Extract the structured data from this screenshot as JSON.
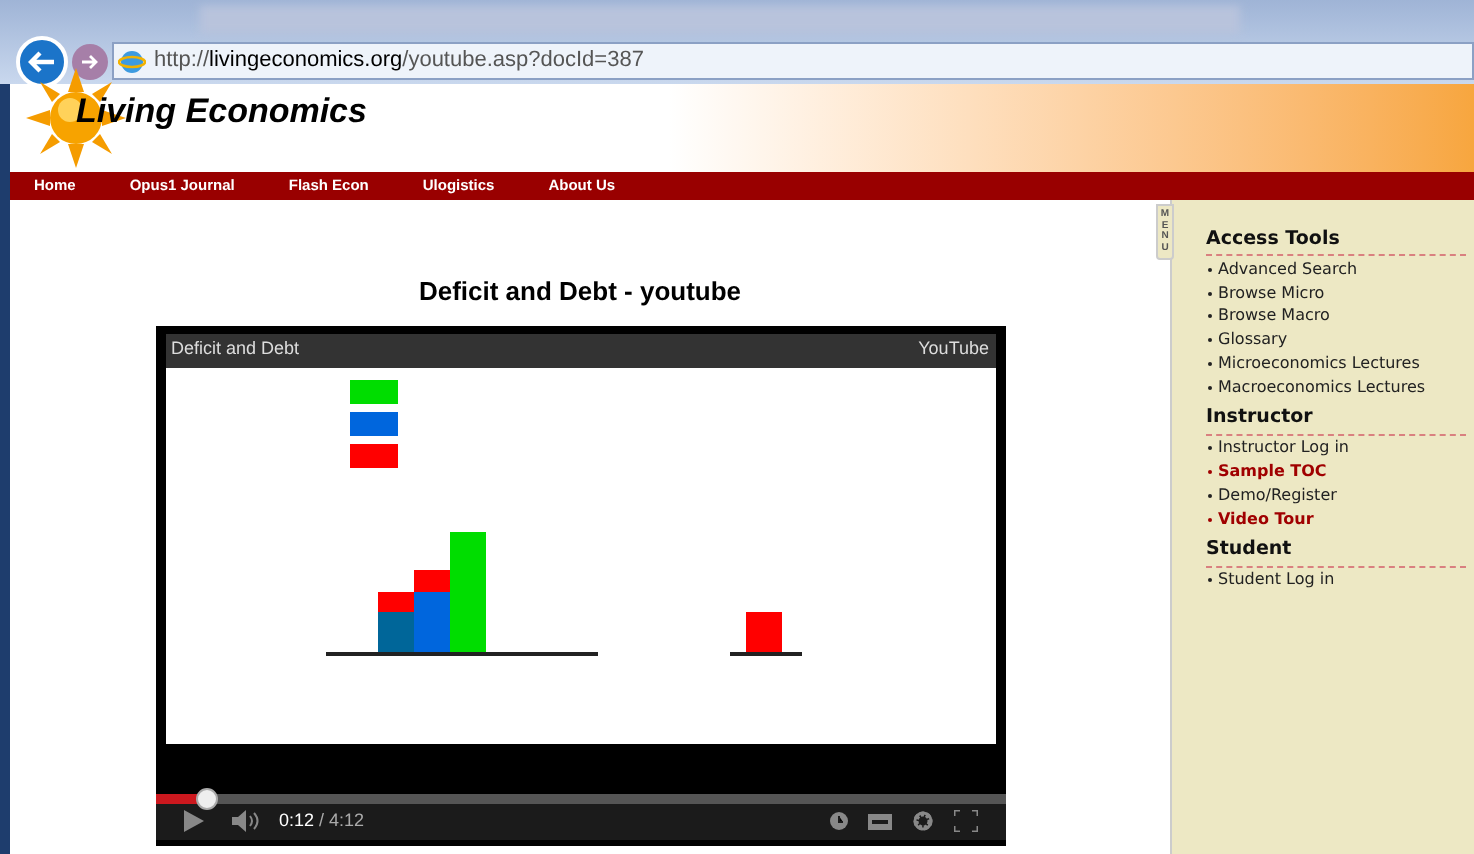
{
  "browser": {
    "url_prefix": "http://",
    "url_domain": "livingeconomics.org",
    "url_path": "/youtube.asp?docId=387"
  },
  "site": {
    "title": "Living Economics"
  },
  "nav": [
    "Home",
    "Opus1 Journal",
    "Flash Econ",
    "Ulogistics",
    "About Us"
  ],
  "page_title": "Deficit and Debt - youtube",
  "video": {
    "title": "Deficit and Debt",
    "brand": "YouTube",
    "kind": "picture",
    "current_time": "0:12",
    "duration": "/ 4:12",
    "progress": {
      "level": 0.06
    }
  },
  "menu_tab": "MENU",
  "sidebar": [
    {
      "heading": "Access Tools",
      "items": [
        {
          "label": "Advanced Search",
          "kind": "plain"
        },
        {
          "label": "Browse Micro",
          "kind": "plain"
        },
        {
          "label": "Browse Macro",
          "kind": "plain"
        },
        {
          "label": "Glossary",
          "kind": "plain"
        },
        {
          "label": "Microeconomics Lectures",
          "kind": "plain"
        },
        {
          "label": "Macroeconomics Lectures",
          "kind": "plain"
        }
      ]
    },
    {
      "heading": "Instructor",
      "items": [
        {
          "label": "Instructor Log in",
          "kind": "plain"
        },
        {
          "label": "Sample TOC",
          "kind": "featured"
        },
        {
          "label": "Demo/Register",
          "kind": "plain"
        },
        {
          "label": "Video Tour",
          "kind": "featured"
        }
      ]
    },
    {
      "heading": "Student",
      "items": [
        {
          "label": "Student Log in",
          "kind": "plain"
        }
      ]
    }
  ]
}
